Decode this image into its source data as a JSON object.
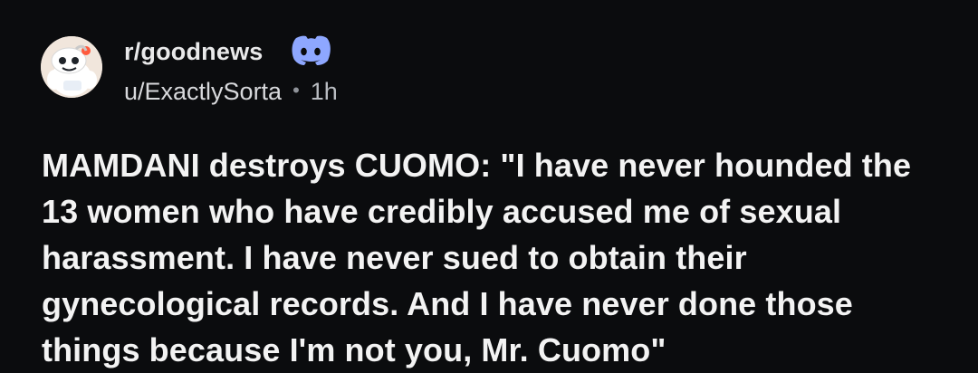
{
  "post": {
    "subreddit": "r/goodnews",
    "author": "u/ExactlySorta",
    "separator": "•",
    "time": "1h",
    "title": "MAMDANI destroys CUOMO: \"I have never hounded the 13 women who have credibly accused me of sexual harassment. I have never sued to obtain their gynecological records. And I have never done those things because I'm not you, Mr. Cuomo\""
  },
  "icons": {
    "avatar": "snoo-avatar-icon",
    "badge": "discord-icon"
  },
  "colors": {
    "background": "#0b0c0e",
    "discord": "#8ea7ff",
    "text": "#f3f3f3"
  }
}
